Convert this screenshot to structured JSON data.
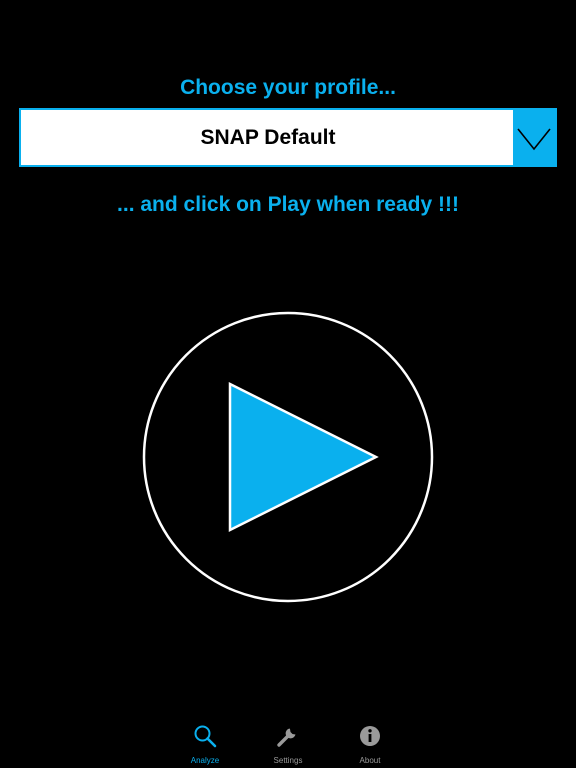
{
  "header": {
    "prompt_top": "Choose your profile...",
    "prompt_bottom": "... and click on Play when ready !!!"
  },
  "profile_selector": {
    "selected_value": "SNAP Default",
    "toggle_icon": "chevron-down-icon"
  },
  "play_button": {
    "icon": "play-icon"
  },
  "tab_bar": {
    "active_tab": "Analyze",
    "items": [
      {
        "label": "Analyze",
        "icon": "search-icon",
        "active": true
      },
      {
        "label": "Settings",
        "icon": "wrench-icon",
        "active": false
      },
      {
        "label": "About",
        "icon": "info-icon",
        "active": false
      }
    ]
  },
  "colors": {
    "accent": "#0ab0ee",
    "background": "#000000",
    "inactive_tab": "#9a9a9a",
    "select_background": "#ffffff"
  }
}
